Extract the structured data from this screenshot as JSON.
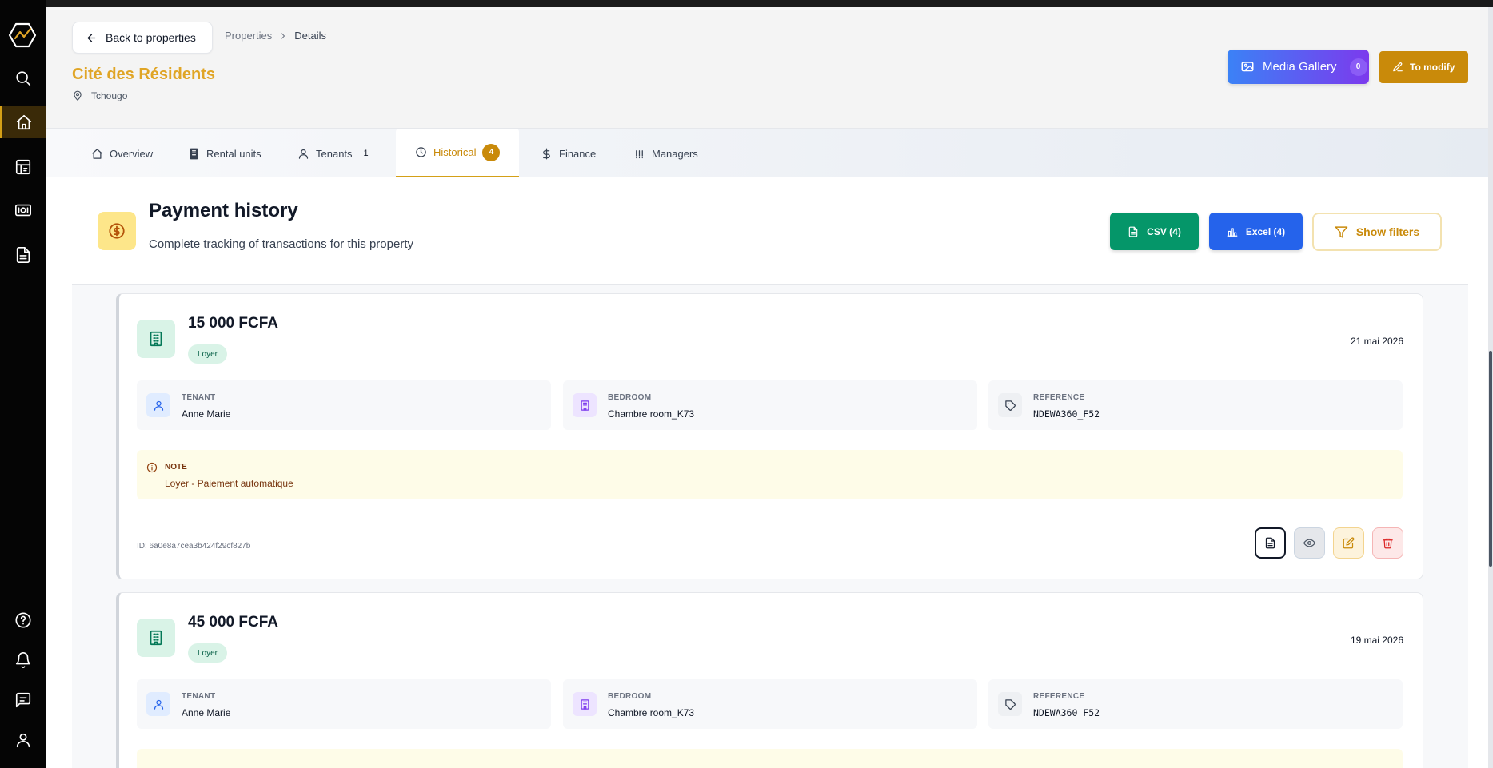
{
  "header": {
    "back_label": "Back to properties",
    "breadcrumb": [
      "Properties",
      "Details"
    ],
    "property_name": "Cité des Résidents",
    "property_location": "Tchougo",
    "media_gallery_label": "Media Gallery",
    "media_gallery_count": "0",
    "modify_label": "To modify"
  },
  "tabs": [
    {
      "label": "Overview",
      "icon": "home-icon"
    },
    {
      "label": "Rental units",
      "icon": "building-icon"
    },
    {
      "label": "Tenants",
      "icon": "user-icon",
      "count": "1"
    },
    {
      "label": "Historical",
      "icon": "clock-icon",
      "count": "4",
      "active": true
    },
    {
      "label": "Finance",
      "icon": "dollar-icon"
    },
    {
      "label": "Managers",
      "icon": "bars-icon"
    }
  ],
  "section": {
    "title": "Payment history",
    "subtitle": "Complete tracking of transactions for this property",
    "csv_label": "CSV (4)",
    "excel_label": "Excel (4)",
    "filters_label": "Show filters"
  },
  "labels": {
    "tenant": "TENANT",
    "bedroom": "BEDROOM",
    "reference": "REFERENCE",
    "note": "NOTE"
  },
  "payments": [
    {
      "amount": "15 000 FCFA",
      "type": "Loyer",
      "date": "21 mai 2026",
      "tenant": "Anne Marie",
      "bedroom": "Chambre room_K73",
      "reference": "NDEWA360_F52",
      "note": "Loyer - Paiement automatique",
      "id": "ID: 6a0e8a7cea3b424f29cf827b"
    },
    {
      "amount": "45 000 FCFA",
      "type": "Loyer",
      "date": "19 mai 2026",
      "tenant": "Anne Marie",
      "bedroom": "Chambre room_K73",
      "reference": "NDEWA360_F52"
    }
  ],
  "colors": {
    "accent": "#d4a017",
    "title": "#e0a526",
    "csv": "#059669",
    "excel": "#2563eb",
    "rail": "#050505"
  }
}
